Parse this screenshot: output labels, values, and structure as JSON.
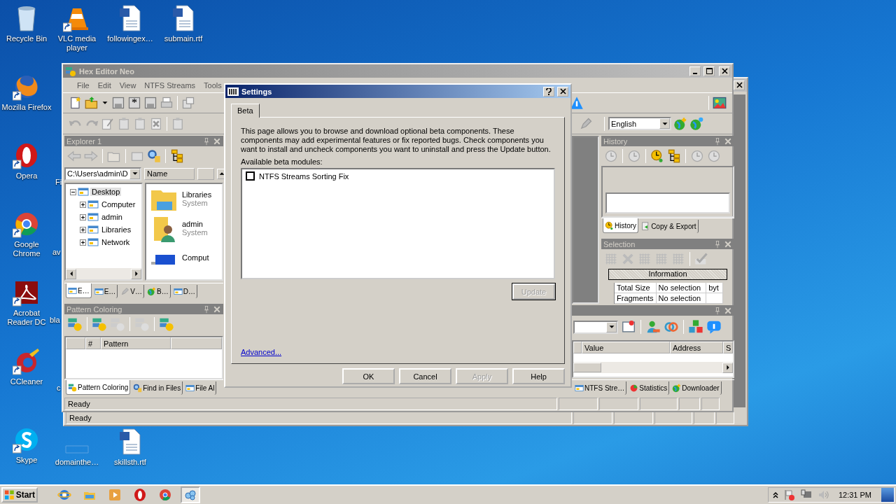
{
  "desktop": {
    "icons": [
      {
        "kind": "recycle",
        "label": "Recycle Bin",
        "shortcut": false
      },
      {
        "kind": "vlc",
        "label": "VLC media player",
        "shortcut": true
      },
      {
        "kind": "word",
        "label": "followingex…",
        "shortcut": false
      },
      {
        "kind": "word",
        "label": "submain.rtf",
        "shortcut": false
      },
      {
        "kind": "firefox",
        "label": "Mozilla Firefox",
        "shortcut": true
      },
      {
        "kind": "opera",
        "label": "Opera",
        "shortcut": true
      },
      {
        "kind": "chrome",
        "label": "Google Chrome",
        "shortcut": true
      },
      {
        "kind": "acrobat",
        "label": "Acrobat Reader DC",
        "shortcut": true
      },
      {
        "kind": "ccleaner",
        "label": "CCleaner",
        "shortcut": true
      },
      {
        "kind": "skype",
        "label": "Skype",
        "shortcut": true
      },
      {
        "kind": "blank",
        "label": "domainthe…",
        "shortcut": false
      },
      {
        "kind": "word",
        "label": "skillsth.rtf",
        "shortcut": false
      }
    ],
    "covered_labels": [
      "Fi",
      "av",
      "bla",
      "c"
    ]
  },
  "back_window": {
    "status": "Ready"
  },
  "main_window": {
    "title": "Hex Editor Neo",
    "menu": [
      "File",
      "Edit",
      "View",
      "NTFS Streams",
      "Tools"
    ],
    "language": "English",
    "explorer": {
      "title": "Explorer 1",
      "path": "C:\\Users\\admin\\D",
      "tree": [
        {
          "label": "Desktop",
          "expanded": true,
          "selected": true,
          "children": [
            {
              "label": "Computer",
              "expanded": false,
              "selected": false
            },
            {
              "label": "admin",
              "expanded": false,
              "selected": false
            },
            {
              "label": "Libraries",
              "expanded": false,
              "selected": false
            },
            {
              "label": "Network",
              "expanded": false,
              "selected": false
            }
          ]
        }
      ],
      "list_column": "Name",
      "files": [
        {
          "kind": "libraries",
          "name": "Libraries",
          "type": "System"
        },
        {
          "kind": "user",
          "name": "admin",
          "type": "System"
        },
        {
          "kind": "computer",
          "name": "Comput"
        }
      ],
      "tabs": [
        {
          "label": "E…",
          "selected": true
        },
        {
          "label": "E…",
          "selected": false
        },
        {
          "label": "V…",
          "selected": false
        },
        {
          "label": "B…",
          "selected": false
        },
        {
          "label": "D…",
          "selected": false
        }
      ]
    },
    "pattern": {
      "title": "Pattern Coloring",
      "columns": [
        "#",
        "Pattern"
      ]
    },
    "left_tabs": [
      {
        "label": "Pattern Coloring",
        "selected": true
      },
      {
        "label": "Find in Files",
        "selected": false
      },
      {
        "label": "File Al",
        "selected": false
      }
    ],
    "history": {
      "title": "History",
      "tabs": [
        {
          "label": "History",
          "selected": true
        },
        {
          "label": "Copy & Export",
          "selected": false
        }
      ]
    },
    "selection": {
      "title": "Selection",
      "group": "Information",
      "rows": [
        {
          "label": "Total Size",
          "value": "No selection",
          "unit": "byt"
        },
        {
          "label": "Fragments",
          "value": "No selection"
        }
      ]
    },
    "bottom_panel": {
      "columns": [
        "Value",
        "Address",
        "S"
      ],
      "tabs": [
        {
          "label": "NTFS Stre…",
          "selected": false
        },
        {
          "label": "Statistics",
          "selected": false
        },
        {
          "label": "Downloader",
          "selected": false
        }
      ]
    },
    "status": "Ready"
  },
  "dialog": {
    "title": "Settings",
    "tabs": [
      {
        "label": "Beta",
        "selected": true
      }
    ],
    "text": "This page allows you to browse and download optional beta components. These components may add experimental features or fix reported bugs. Check components you want to install and uncheck components you want to uninstall and press the Update button.",
    "list_label": "Available beta modules:",
    "modules": [
      {
        "name": "NTFS Streams Sorting Fix",
        "checked": false
      }
    ],
    "update": {
      "label": "Update",
      "disabled": true
    },
    "link": "Advanced...",
    "buttons": [
      {
        "label": "OK",
        "disabled": false
      },
      {
        "label": "Cancel",
        "disabled": false
      },
      {
        "label": "Apply",
        "disabled": true
      },
      {
        "label": "Help",
        "disabled": false
      }
    ]
  },
  "taskbar": {
    "start": "Start",
    "apps": [
      {
        "kind": "ie",
        "selected": false
      },
      {
        "kind": "explorer",
        "selected": false
      },
      {
        "kind": "media",
        "selected": false
      },
      {
        "kind": "opera",
        "selected": false
      },
      {
        "kind": "chrome",
        "selected": false
      },
      {
        "kind": "hexeditor",
        "selected": true
      }
    ],
    "time": "12:31 PM"
  }
}
